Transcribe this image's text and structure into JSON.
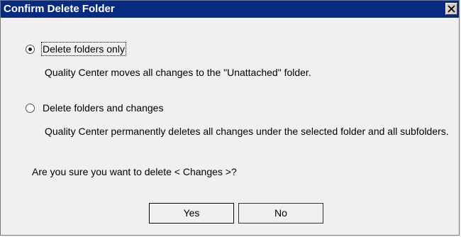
{
  "dialog": {
    "title": "Confirm Delete Folder",
    "close_glyph": "×"
  },
  "options": [
    {
      "label": "Delete folders only",
      "description": "Quality Center moves all changes to the \"Unattached\" folder.",
      "selected": true
    },
    {
      "label": "Delete folders and changes",
      "description": "Quality Center permanently deletes all changes under the selected folder and all subfolders.",
      "selected": false
    }
  ],
  "question": "Are you sure you want to delete < Changes >?",
  "buttons": {
    "yes_label": "Yes",
    "no_label": "No"
  },
  "colors": {
    "titlebar": "#082b82",
    "background": "#f0f0f0"
  }
}
